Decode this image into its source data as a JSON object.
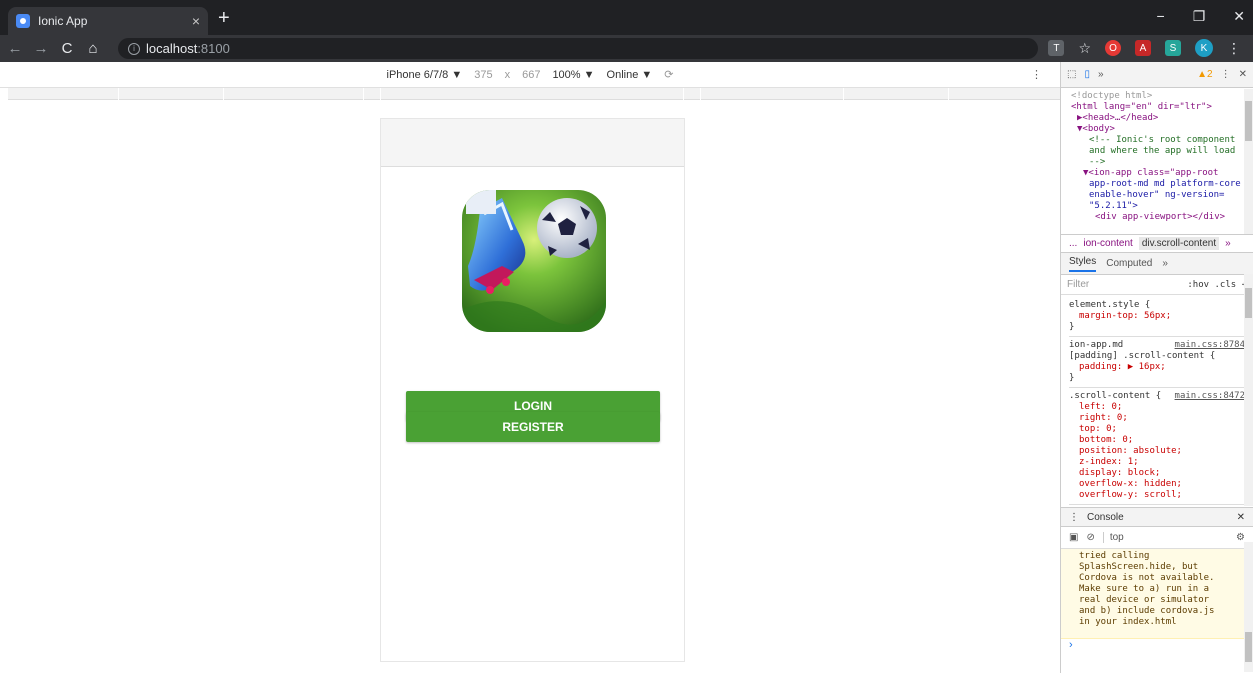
{
  "browser": {
    "tab_title": "Ionic App",
    "tab_close": "×",
    "new_tab": "+",
    "minimize": "−",
    "restore": "❐",
    "close": "✕",
    "back": "←",
    "forward": "→",
    "reload": "C",
    "home": "⌂",
    "url_host": "localhost",
    "url_port": ":8100",
    "star": "☆",
    "profile_initial": "K"
  },
  "device_toolbar": {
    "device": "iPhone 6/7/8 ▼",
    "width": "375",
    "times": "x",
    "height": "667",
    "zoom": "100% ▼",
    "network": "Online ▼",
    "kebab": "⋮"
  },
  "app": {
    "login_label": "LOGIN",
    "register_label": "REGISTER",
    "accent": "#4aa134"
  },
  "devtools": {
    "more": "»",
    "warnings": "▲2",
    "dots": "⋮",
    "close": "✕",
    "elements": [
      "<!doctype html>",
      "<html lang=\"en\" dir=\"ltr\">",
      "▶<head>…</head>",
      "▼<body>",
      "<!-- Ionic's root component",
      "and where the app will load",
      "-->",
      "▼<ion-app class=\"app-root",
      "app-root-md md platform-core",
      "enable-hover\" ng-version=",
      "\"5.2.11\">",
      "<div app-viewport></div>"
    ],
    "crumbs": [
      "...",
      "ion-content",
      "div.scroll-content",
      "»"
    ],
    "subtabs": [
      "Styles",
      "Computed",
      "»"
    ],
    "filter": "Filter",
    "filter_opts": ":hov  .cls  +",
    "rules": [
      {
        "selector": "element.style {",
        "source": "",
        "props": [
          "margin-top: 56px;"
        ]
      },
      {
        "selector": "ion-app.md [padding] .scroll-content {",
        "source": "main.css:8784",
        "props": [
          "padding: ▶ 16px;"
        ]
      },
      {
        "selector": ".scroll-content {",
        "source": "main.css:8472",
        "props": [
          "left: 0;",
          "right: 0;",
          "top: 0;",
          "bottom: 0;",
          "position: absolute;",
          "z-index: 1;",
          "display: block;",
          "overflow-x: hidden;",
          "overflow-y: scroll;"
        ]
      }
    ],
    "console_title": "Console",
    "console_context": "top",
    "console_lines": [
      "tried calling",
      "SplashScreen.hide, but",
      "Cordova is not available.",
      "Make sure to a) run in a",
      "real device or simulator",
      "and b) include cordova.js",
      "in your index.html"
    ],
    "prompt": "›"
  }
}
